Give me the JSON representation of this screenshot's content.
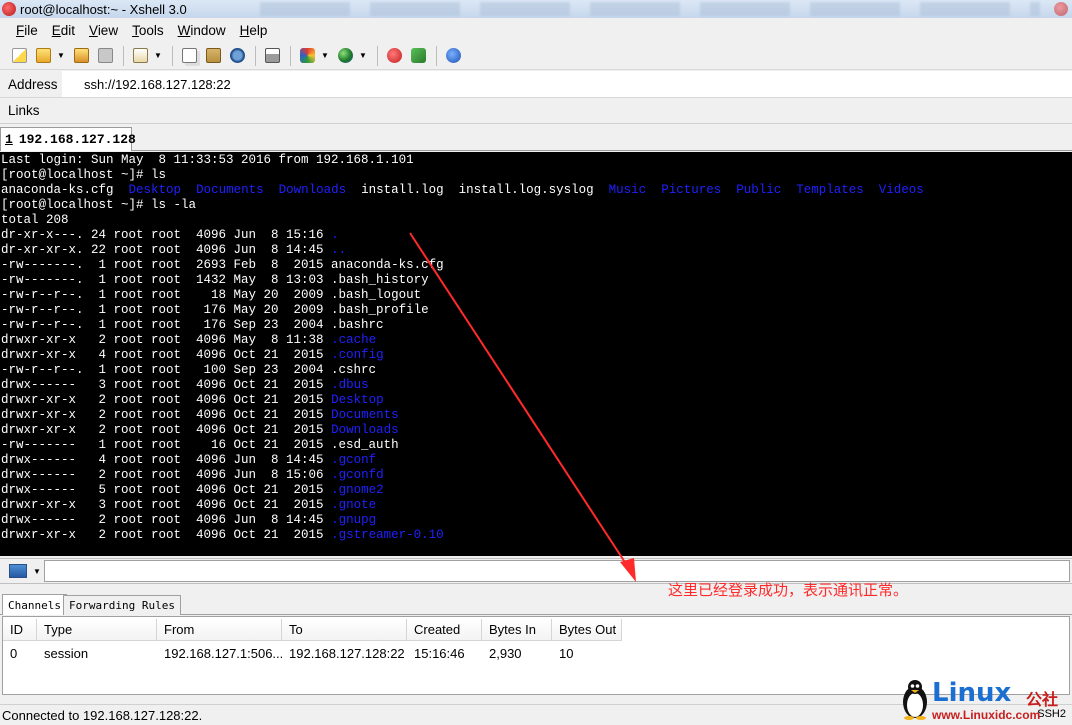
{
  "window": {
    "title": "root@localhost:~ - Xshell 3.0"
  },
  "menu": {
    "items": [
      "File",
      "Edit",
      "View",
      "Tools",
      "Window",
      "Help"
    ]
  },
  "toolbar": {
    "icons": [
      "new-session-icon",
      "open-folder-icon",
      "reconnect-icon",
      "disconnect-icon",
      "properties-icon",
      "copy-icon",
      "paste-icon",
      "find-icon",
      "print-icon",
      "color-scheme-icon",
      "globe-icon",
      "xftp-icon",
      "script-icon",
      "help-icon"
    ]
  },
  "address": {
    "label": "Address",
    "value": "ssh://192.168.127.128:22"
  },
  "links": {
    "label": "Links"
  },
  "session_tab": {
    "number": "1",
    "host": "192.168.127.128"
  },
  "terminal": {
    "lines": [
      {
        "segments": [
          {
            "t": "Last login: Sun May  8 11:33:53 2016 from 192.168.1.101"
          }
        ]
      },
      {
        "segments": [
          {
            "t": "[root@localhost ~]# ls"
          }
        ]
      },
      {
        "segments": [
          {
            "t": "anaconda-ks.cfg  "
          },
          {
            "t": "Desktop",
            "c": "dir"
          },
          {
            "t": "  "
          },
          {
            "t": "Documents",
            "c": "dir"
          },
          {
            "t": "  "
          },
          {
            "t": "Downloads",
            "c": "dir"
          },
          {
            "t": "  install.log  install.log.syslog  "
          },
          {
            "t": "Music",
            "c": "dir"
          },
          {
            "t": "  "
          },
          {
            "t": "Pictures",
            "c": "dir"
          },
          {
            "t": "  "
          },
          {
            "t": "Public",
            "c": "dir"
          },
          {
            "t": "  "
          },
          {
            "t": "Templates",
            "c": "dir"
          },
          {
            "t": "  "
          },
          {
            "t": "Videos",
            "c": "dir"
          }
        ]
      },
      {
        "segments": [
          {
            "t": "[root@localhost ~]# ls -la"
          }
        ]
      },
      {
        "segments": [
          {
            "t": "total 208"
          }
        ]
      },
      {
        "segments": [
          {
            "t": "dr-xr-x---. 24 root root  4096 Jun  8 15:16 "
          },
          {
            "t": ".",
            "c": "dir"
          }
        ]
      },
      {
        "segments": [
          {
            "t": "dr-xr-xr-x. 22 root root  4096 Jun  8 14:45 "
          },
          {
            "t": "..",
            "c": "dir"
          }
        ]
      },
      {
        "segments": [
          {
            "t": "-rw-------.  1 root root  2693 Feb  8  2015 anaconda-ks.cfg"
          }
        ]
      },
      {
        "segments": [
          {
            "t": "-rw-------.  1 root root  1432 May  8 13:03 .bash_history"
          }
        ]
      },
      {
        "segments": [
          {
            "t": "-rw-r--r--.  1 root root    18 May 20  2009 .bash_logout"
          }
        ]
      },
      {
        "segments": [
          {
            "t": "-rw-r--r--.  1 root root   176 May 20  2009 .bash_profile"
          }
        ]
      },
      {
        "segments": [
          {
            "t": "-rw-r--r--.  1 root root   176 Sep 23  2004 .bashrc"
          }
        ]
      },
      {
        "segments": [
          {
            "t": "drwxr-xr-x   2 root root  4096 May  8 11:38 "
          },
          {
            "t": ".cache",
            "c": "dir"
          }
        ]
      },
      {
        "segments": [
          {
            "t": "drwxr-xr-x   4 root root  4096 Oct 21  2015 "
          },
          {
            "t": ".config",
            "c": "dir"
          }
        ]
      },
      {
        "segments": [
          {
            "t": "-rw-r--r--.  1 root root   100 Sep 23  2004 .cshrc"
          }
        ]
      },
      {
        "segments": [
          {
            "t": "drwx------   3 root root  4096 Oct 21  2015 "
          },
          {
            "t": ".dbus",
            "c": "dir"
          }
        ]
      },
      {
        "segments": [
          {
            "t": "drwxr-xr-x   2 root root  4096 Oct 21  2015 "
          },
          {
            "t": "Desktop",
            "c": "dir"
          }
        ]
      },
      {
        "segments": [
          {
            "t": "drwxr-xr-x   2 root root  4096 Oct 21  2015 "
          },
          {
            "t": "Documents",
            "c": "dir"
          }
        ]
      },
      {
        "segments": [
          {
            "t": "drwxr-xr-x   2 root root  4096 Oct 21  2015 "
          },
          {
            "t": "Downloads",
            "c": "dir"
          }
        ]
      },
      {
        "segments": [
          {
            "t": "-rw-------   1 root root    16 Oct 21  2015 .esd_auth"
          }
        ]
      },
      {
        "segments": [
          {
            "t": "drwx------   4 root root  4096 Jun  8 14:45 "
          },
          {
            "t": ".gconf",
            "c": "dir"
          }
        ]
      },
      {
        "segments": [
          {
            "t": "drwx------   2 root root  4096 Jun  8 15:06 "
          },
          {
            "t": ".gconfd",
            "c": "dir"
          }
        ]
      },
      {
        "segments": [
          {
            "t": "drwx------   5 root root  4096 Oct 21  2015 "
          },
          {
            "t": ".gnome2",
            "c": "dir"
          }
        ]
      },
      {
        "segments": [
          {
            "t": "drwxr-xr-x   3 root root  4096 Oct 21  2015 "
          },
          {
            "t": ".gnote",
            "c": "dir"
          }
        ]
      },
      {
        "segments": [
          {
            "t": "drwx------   2 root root  4096 Jun  8 14:45 "
          },
          {
            "t": ".gnupg",
            "c": "dir"
          }
        ]
      },
      {
        "segments": [
          {
            "t": "drwxr-xr-x   2 root root  4096 Oct 21  2015 "
          },
          {
            "t": ".gstreamer-0.10",
            "c": "dir"
          }
        ]
      }
    ]
  },
  "annotation": {
    "text": "这里已经登录成功，表示通讯正常。"
  },
  "bottom_panel": {
    "tabs": [
      "Channels",
      "Forwarding Rules"
    ],
    "active_tab": "Channels",
    "columns": [
      "ID",
      "Type",
      "From",
      "To",
      "Created",
      "Bytes In",
      "Bytes Out"
    ],
    "rows": [
      [
        "0",
        "session",
        "192.168.127.1:506...",
        "192.168.127.128:22",
        "15:16:46",
        "2,930",
        "10"
      ]
    ]
  },
  "status": {
    "text": "Connected to 192.168.127.128:22.",
    "protocol": "SSH2"
  },
  "watermark": {
    "brand": "Linux",
    "brand_cn": "公社",
    "url": "www.Linuxidc.com"
  },
  "colors": {
    "terminal_bg": "#000000",
    "terminal_fg": "#ffffff",
    "dir": "#2020ff",
    "annotation": "#ff2a2a"
  }
}
